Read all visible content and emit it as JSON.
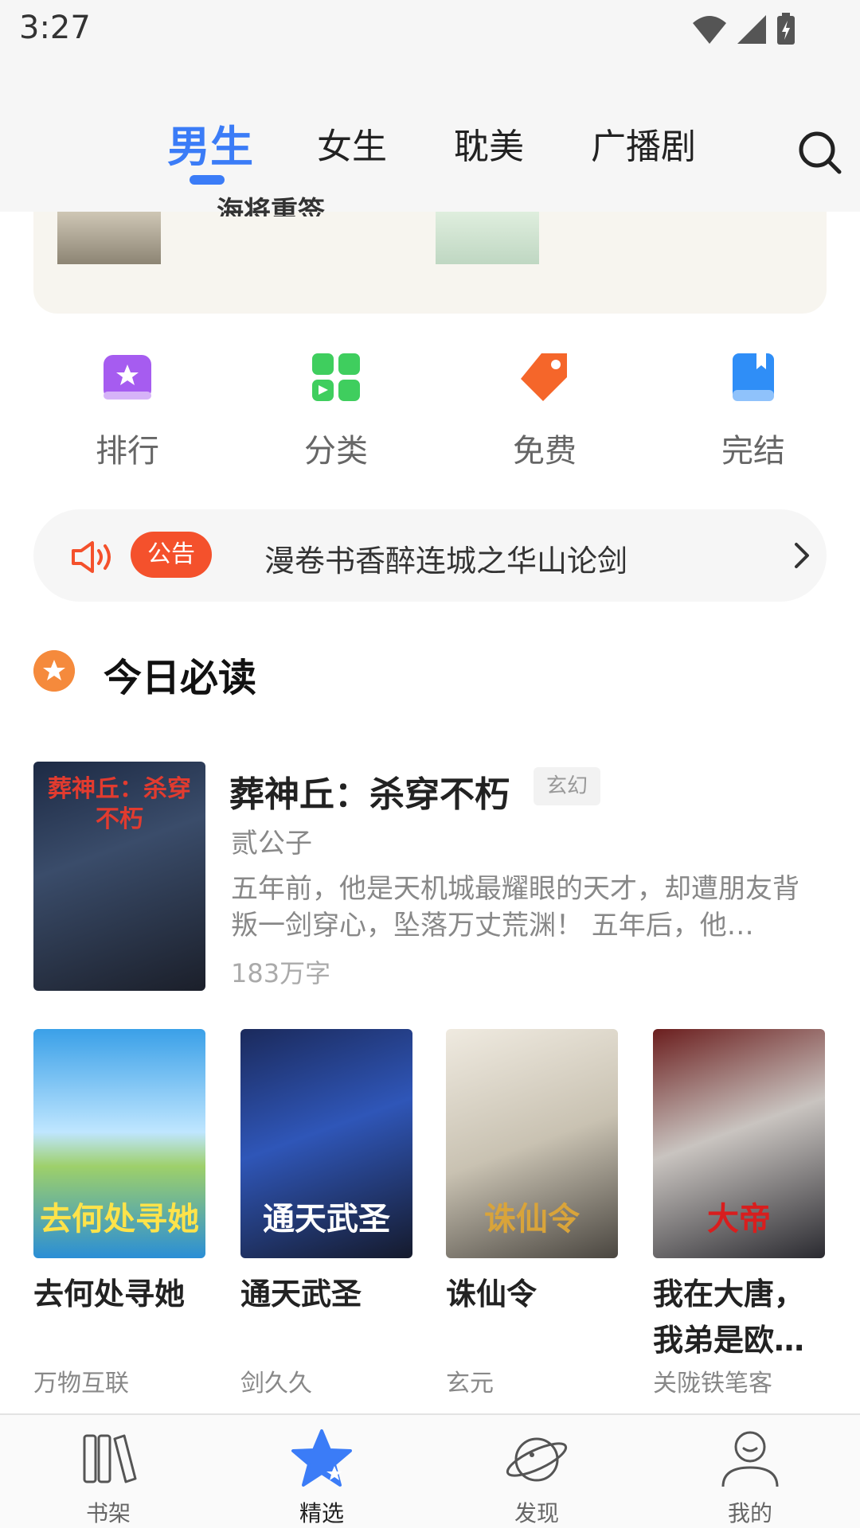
{
  "status_bar": {
    "time": "3:27"
  },
  "top_tabs": {
    "items": [
      "男生",
      "女生",
      "耽美",
      "广播剧"
    ],
    "active_index": 0
  },
  "banner": {
    "cut_text": "海将重签"
  },
  "quick_entries": [
    {
      "label": "排行",
      "icon": "ranking-icon",
      "color": "#a65cf0"
    },
    {
      "label": "分类",
      "icon": "category-icon",
      "color": "#3fce5e"
    },
    {
      "label": "免费",
      "icon": "free-tag-icon",
      "color": "#f5662a"
    },
    {
      "label": "完结",
      "icon": "completed-book-icon",
      "color": "#2f8ef7"
    }
  ],
  "notice": {
    "badge": "公告",
    "text": "漫卷书香醉连城之华山论剑"
  },
  "section": {
    "title": "今日必读"
  },
  "featured_book": {
    "title": "葬神丘：杀穿不朽",
    "genre": "玄幻",
    "author": "贰公子",
    "description": "五年前，他是天机城最耀眼的天才，却遭朋友背叛一剑穿心，坠落万丈荒渊！ 五年后，他…",
    "word_count": "183万字",
    "cover_text": "葬神丘：杀穿不朽"
  },
  "grid_books": [
    {
      "title": "去何处寻她",
      "author": "万物互联",
      "cover_text": "去何处寻她"
    },
    {
      "title": "通天武圣",
      "author": "剑久久",
      "cover_text": "通天武圣"
    },
    {
      "title": "诛仙令",
      "author": "玄元",
      "cover_text": "诛仙令"
    },
    {
      "title": "我在大唐，我弟是欧…",
      "author": "关陇铁笔客",
      "cover_text": "大帝"
    }
  ],
  "bottom_nav": {
    "items": [
      "书架",
      "精选",
      "发现",
      "我的"
    ],
    "active_index": 1
  },
  "colors": {
    "accent": "#3b7cf7",
    "notice_badge": "#f4512c",
    "section_icon": "#f58a3c"
  }
}
